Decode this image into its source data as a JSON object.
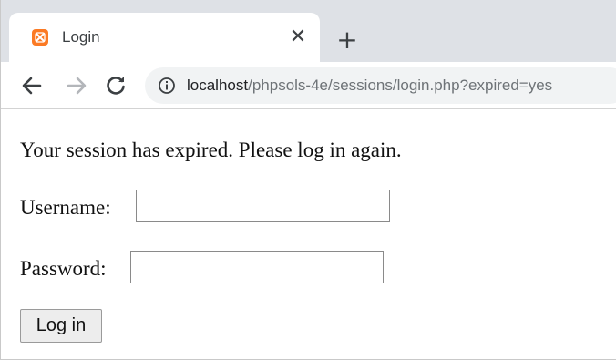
{
  "tab": {
    "title": "Login",
    "favicon": "xampp-icon",
    "close_glyph": "✕",
    "new_tab_glyph": "+"
  },
  "toolbar": {
    "back_icon": "arrow-left-icon",
    "forward_icon": "arrow-right-icon",
    "reload_icon": "reload-icon",
    "info_icon": "info-icon",
    "url_host": "localhost",
    "url_path": "/phpsols-4e/sessions/login.php?expired=yes"
  },
  "page": {
    "message": "Your session has expired. Please log in again.",
    "username_label": "Username:",
    "username_value": "",
    "password_label": "Password:",
    "password_value": "",
    "login_button": "Log in"
  },
  "colors": {
    "tabstrip_bg": "#dee1e6",
    "omnibox_bg": "#f1f3f4",
    "favicon_orange": "#fb7a24"
  }
}
